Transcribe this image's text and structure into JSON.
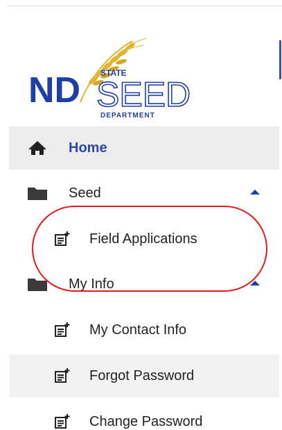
{
  "logo": {
    "abbr": "ND",
    "top_word": "STATE",
    "main_word": "SEED",
    "bottom_word": "DEPARTMENT",
    "colors": {
      "navy": "#1f3fa8",
      "wheat": "#e0b531"
    }
  },
  "menu": {
    "items": [
      {
        "label": "Home",
        "icon": "home-icon",
        "active": true
      },
      {
        "label": "Seed",
        "icon": "folder-icon",
        "expanded": true
      },
      {
        "label": "Field Applications",
        "icon": "post-add-icon"
      },
      {
        "label": "My Info",
        "icon": "folder-icon",
        "expanded": true
      },
      {
        "label": "My Contact Info",
        "icon": "post-add-icon"
      },
      {
        "label": "Forgot Password",
        "icon": "post-add-icon",
        "hovered": true
      },
      {
        "label": "Change Password",
        "icon": "post-add-icon"
      }
    ]
  },
  "colors": {
    "accent": "#2f46a6",
    "active_bg": "#ececec",
    "annotation": "#e01b1b"
  }
}
